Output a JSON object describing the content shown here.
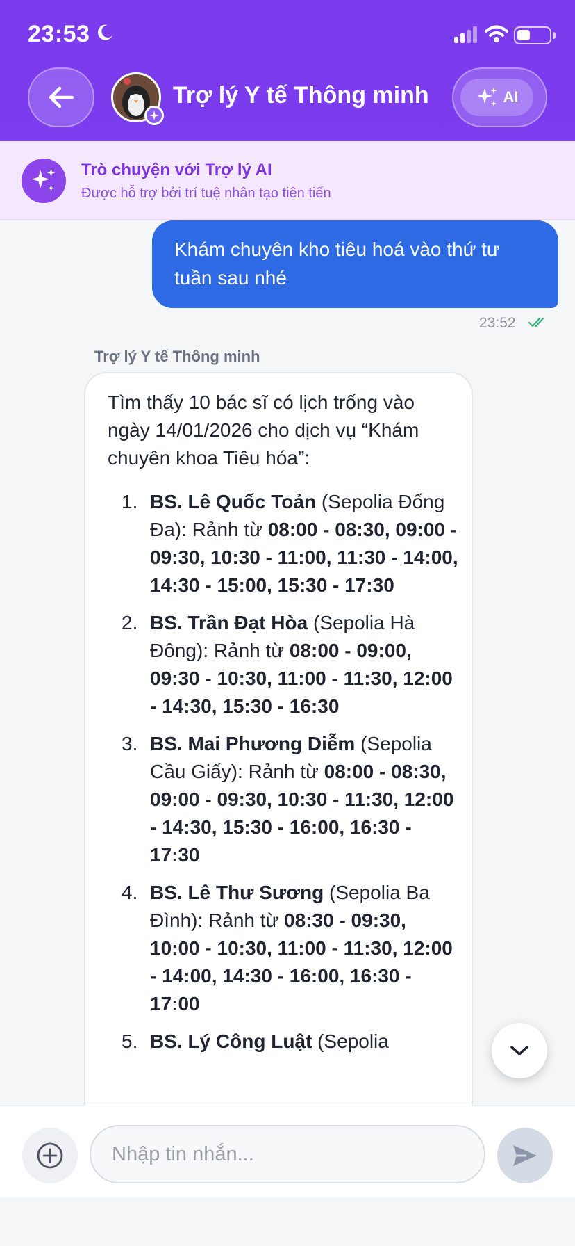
{
  "status_bar": {
    "time": "23:53"
  },
  "header": {
    "title": "Trợ lý Y tế Thông minh",
    "ai_label": "AI"
  },
  "banner": {
    "title": "Trò chuyện với Trợ lý AI",
    "subtitle": "Được hỗ trợ bởi trí tuệ nhân tạo tiên tiến"
  },
  "messages": {
    "user": {
      "text": "Khám chuyên kho tiêu hoá vào thứ tư tuần sau nhé",
      "time": "23:52"
    },
    "bot": {
      "sender": "Trợ lý Y tế Thông minh",
      "intro": "Tìm thấy 10 bác sĩ có lịch trống vào ngày 14/01/2026 cho dịch vụ “Khám chuyên khoa Tiêu hóa”:",
      "doctors": [
        {
          "num": "1.",
          "name": "BS. Lê Quốc Toản",
          "branch": " (Sepolia Đống Đa): Rảnh từ ",
          "slots": "08:00 - 08:30, 09:00 - 09:30, 10:30 - 11:00, 11:30 - 14:00, 14:30 - 15:00, 15:30 - 17:30"
        },
        {
          "num": "2.",
          "name": "BS. Trần Đạt Hòa",
          "branch": " (Sepolia Hà Đông): Rảnh từ ",
          "slots": "08:00 - 09:00, 09:30 - 10:30, 11:00 - 11:30, 12:00 - 14:30, 15:30 - 16:30"
        },
        {
          "num": "3.",
          "name": "BS. Mai Phương Diễm",
          "branch": " (Sepolia Cầu Giấy): Rảnh từ ",
          "slots": "08:00 - 08:30, 09:00 - 09:30, 10:30 - 11:30, 12:00 - 14:30, 15:30 - 16:00, 16:30 - 17:30"
        },
        {
          "num": "4.",
          "name": "BS. Lê Thư Sương",
          "branch": " (Sepolia Ba Đình): Rảnh từ ",
          "slots": "08:30 - 09:30, 10:00 - 10:30, 11:00 - 11:30, 12:00 - 14:00, 14:30 - 16:00, 16:30 - 17:00"
        },
        {
          "num": "5.",
          "name": "BS. Lý Công Luật",
          "branch": " (Sepolia",
          "slots": ""
        }
      ]
    }
  },
  "input": {
    "placeholder": "Nhập tin nhắn..."
  },
  "icons": {
    "back": "arrow-left-icon",
    "ai": "sparkles-icon",
    "banner": "sparkles-icon",
    "read_receipt": "double-check-icon",
    "scroll_down": "chevron-down-icon",
    "attach": "plus-circle-icon",
    "send": "send-icon"
  },
  "colors": {
    "header": "#7c3aed",
    "banner_bg": "#f3e8fd",
    "user_bubble": "#2d6ae3",
    "accent": "#8b45ea"
  }
}
